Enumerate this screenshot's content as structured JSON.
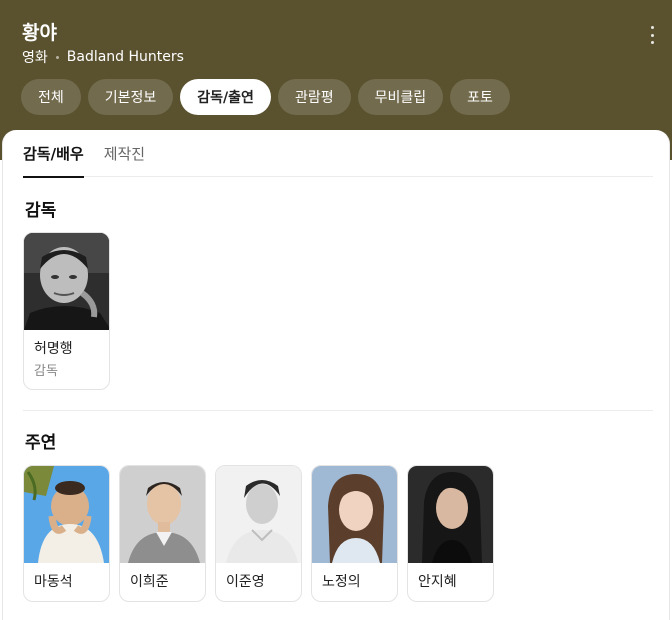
{
  "header": {
    "title": "황야",
    "category": "영화",
    "original_title": "Badland Hunters",
    "more_icon": "more-vertical-icon"
  },
  "tabs": [
    {
      "label": "전체",
      "active": false
    },
    {
      "label": "기본정보",
      "active": false
    },
    {
      "label": "감독/출연",
      "active": true
    },
    {
      "label": "관람평",
      "active": false
    },
    {
      "label": "무비클립",
      "active": false
    },
    {
      "label": "포토",
      "active": false
    }
  ],
  "subtabs": [
    {
      "label": "감독/배우",
      "active": true
    },
    {
      "label": "제작진",
      "active": false
    }
  ],
  "director_section": {
    "title": "감독",
    "people": [
      {
        "name": "허명행",
        "role": "감독"
      }
    ]
  },
  "cast_section": {
    "title": "주연",
    "people": [
      {
        "name": "마동석"
      },
      {
        "name": "이희준"
      },
      {
        "name": "이준영"
      },
      {
        "name": "노정의"
      },
      {
        "name": "안지혜"
      }
    ]
  },
  "colors": {
    "header_bg": "#5a522f",
    "active_tab_bg": "#ffffff"
  }
}
